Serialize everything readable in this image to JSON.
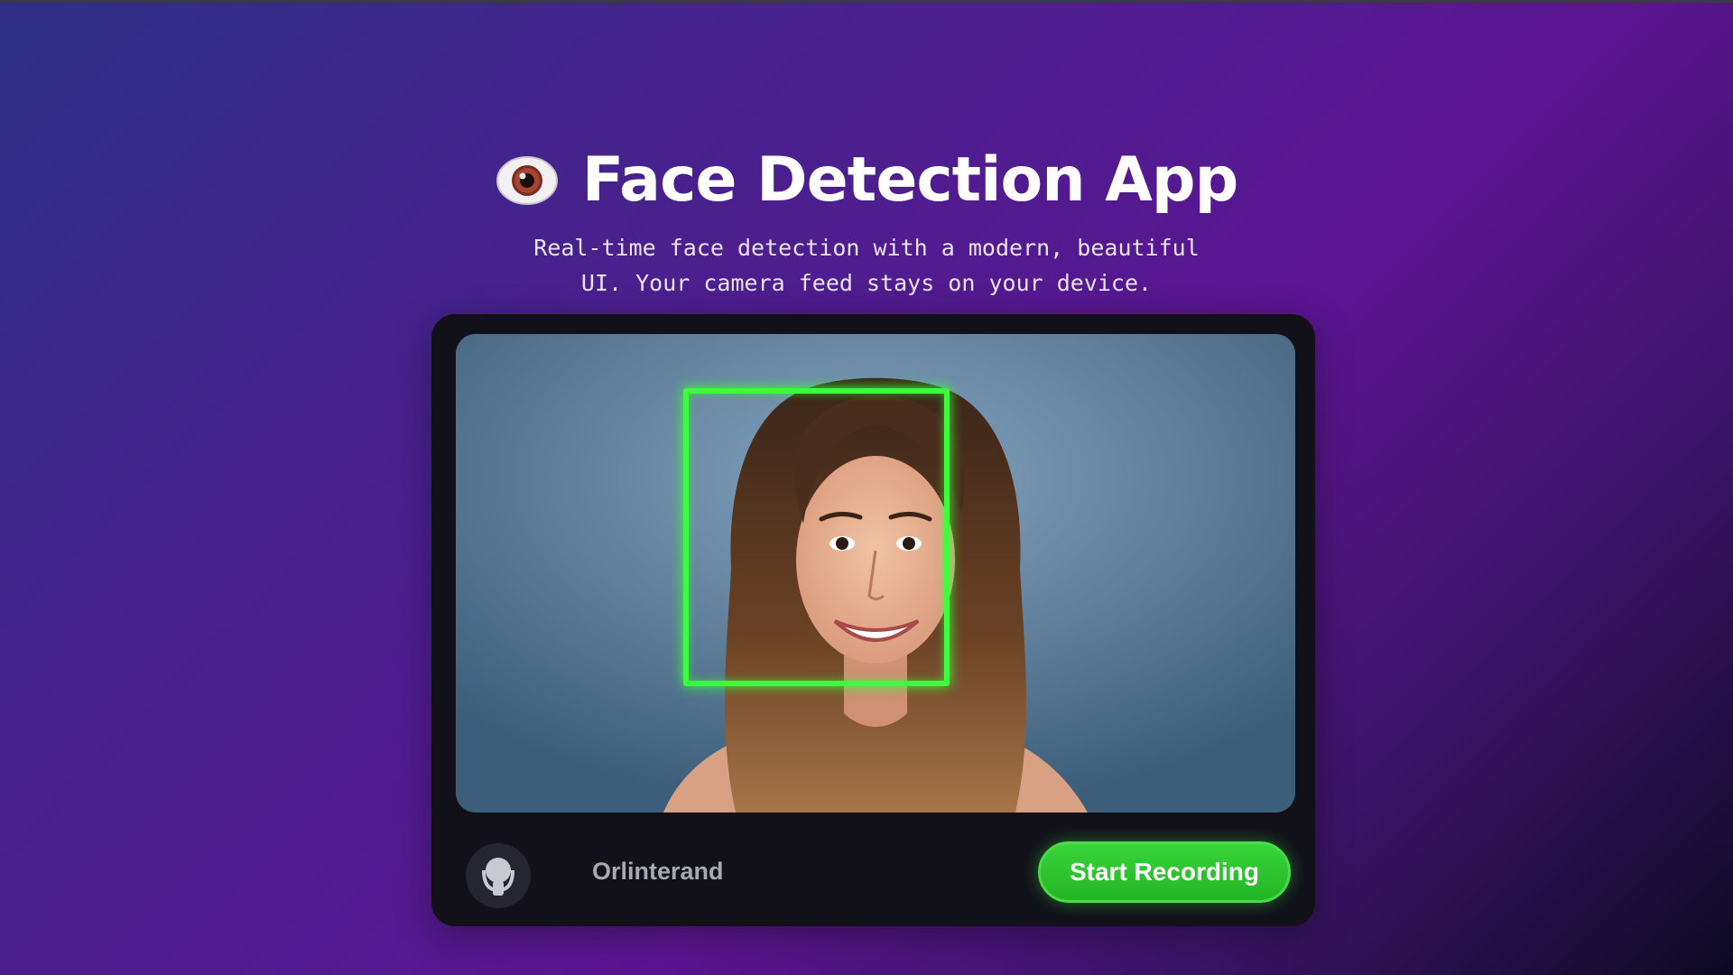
{
  "header": {
    "icon": "eye-icon",
    "title": "Face Detection App",
    "subtitle_line1": "Real-time face detection with a modern, beautiful",
    "subtitle_line2": "UI. Your camera feed stays on your device."
  },
  "camera": {
    "face_box_color": "#3cff3c"
  },
  "controls": {
    "avatar_icon": "user-avatar-icon",
    "username": "Orlinterand",
    "record_label": "Start Recording",
    "record_color": "#2cc52e"
  }
}
